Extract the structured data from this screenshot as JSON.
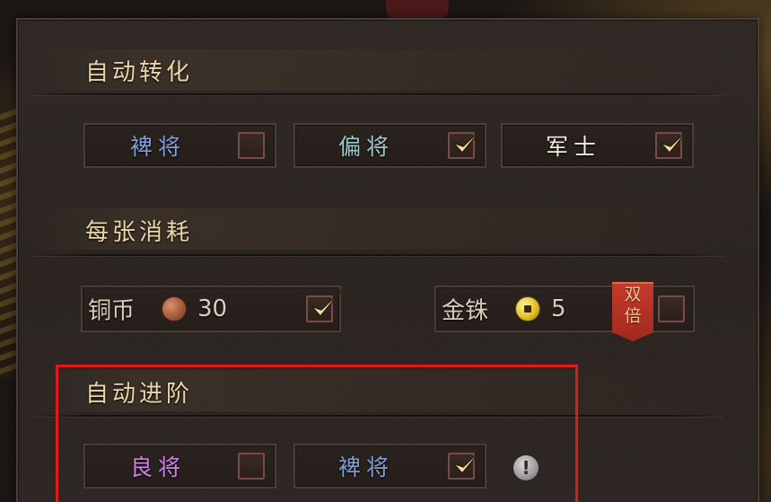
{
  "colors": {
    "title_gold": "#e9d7a8",
    "blue_label": "#7f9fd6",
    "teal_label": "#9ec8c8",
    "white_label": "#f0ece2",
    "purple_label": "#d080e8",
    "currency_text": "#d9cdbb",
    "check_gold": "#f3dfa0",
    "highlight_red": "#e01a1a"
  },
  "auto_convert": {
    "title": "自动转化",
    "options": [
      {
        "label": "裨将",
        "checked": false,
        "color": "#7f9fd6",
        "icon": "empty-checkbox"
      },
      {
        "label": "偏将",
        "checked": true,
        "color": "#9ec8c8",
        "icon": "checkmark-icon"
      },
      {
        "label": "军士",
        "checked": true,
        "color": "#f0ece2",
        "icon": "checkmark-icon"
      }
    ]
  },
  "cost_per_card": {
    "title": "每张消耗",
    "copper": {
      "label": "铜币",
      "icon": "copper-coin-icon",
      "amount": "30",
      "checked": true
    },
    "gold": {
      "label": "金铢",
      "icon": "gold-coin-icon",
      "amount": "5",
      "checked": false,
      "badge": [
        "双",
        "倍"
      ]
    }
  },
  "auto_advance": {
    "title": "自动进阶",
    "options": [
      {
        "label": "良将",
        "checked": false,
        "color": "#d080e8",
        "icon": "empty-checkbox"
      },
      {
        "label": "裨将",
        "checked": true,
        "color": "#7f9fd6",
        "icon": "checkmark-icon"
      }
    ],
    "info_icon": "!"
  }
}
